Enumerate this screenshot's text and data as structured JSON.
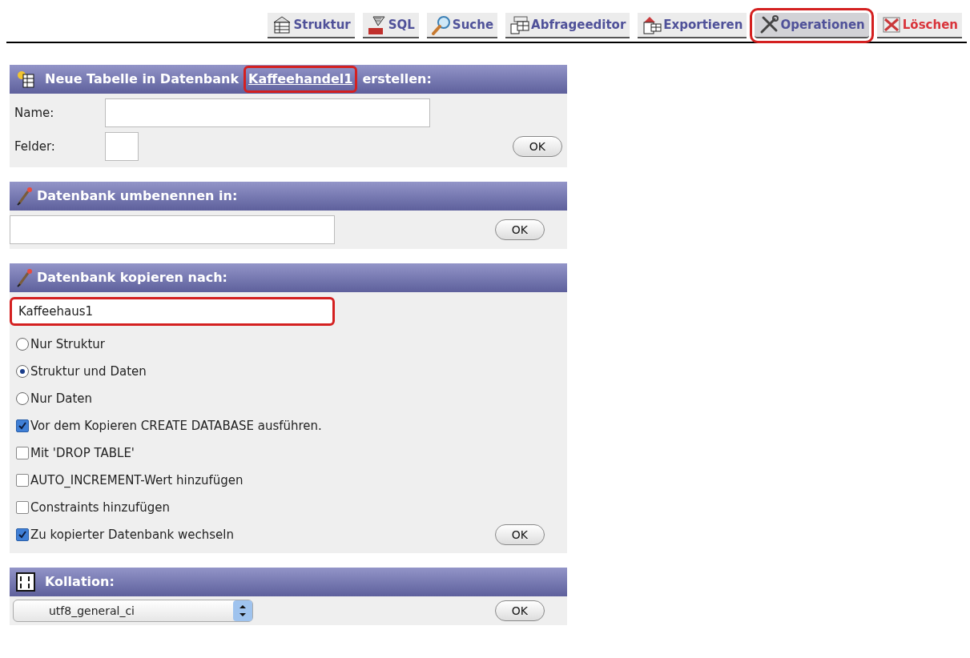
{
  "tabs": [
    {
      "label": "Struktur",
      "selected": false,
      "highlighted": false,
      "color": "#4f5199"
    },
    {
      "label": "SQL",
      "selected": false,
      "highlighted": false,
      "color": "#4f5199"
    },
    {
      "label": "Suche",
      "selected": false,
      "highlighted": false,
      "color": "#4f5199"
    },
    {
      "label": "Abfrageeditor",
      "selected": false,
      "highlighted": false,
      "color": "#4f5199"
    },
    {
      "label": "Exportieren",
      "selected": false,
      "highlighted": false,
      "color": "#4f5199"
    },
    {
      "label": "Operationen",
      "selected": true,
      "highlighted": true,
      "color": "#4f5199"
    },
    {
      "label": "Löschen",
      "selected": false,
      "highlighted": false,
      "color": "#d9343b"
    }
  ],
  "create_table": {
    "title_before": "Neue Tabelle in Datenbank",
    "database_link": "Kaffeehandel1",
    "link_highlighted": true,
    "title_after": "erstellen:",
    "fields": [
      {
        "label": "Name:",
        "kind": "wide"
      },
      {
        "label": "Felder:",
        "kind": "narrow"
      }
    ],
    "button": "OK"
  },
  "rename": {
    "title": "Datenbank umbenennen in:",
    "button": "OK"
  },
  "copy": {
    "title": "Datenbank kopieren nach:",
    "value": "Kaffeehaus1",
    "value_highlighted": true,
    "options": [
      {
        "kind": "radio",
        "label": "Nur Struktur",
        "selected": false
      },
      {
        "kind": "radio",
        "label": "Struktur und Daten",
        "selected": true
      },
      {
        "kind": "radio",
        "label": "Nur Daten",
        "selected": false
      },
      {
        "kind": "checkbox",
        "label": "Vor dem Kopieren CREATE DATABASE ausführen.",
        "checked": true
      },
      {
        "kind": "checkbox",
        "label": "Mit 'DROP TABLE'",
        "checked": false
      },
      {
        "kind": "checkbox",
        "label": "AUTO_INCREMENT-Wert hinzufügen",
        "checked": false
      },
      {
        "kind": "checkbox",
        "label": "Constraints hinzufügen",
        "checked": false
      },
      {
        "kind": "checkbox",
        "label": "Zu kopierter Datenbank wechseln",
        "checked": true
      }
    ],
    "button": "OK"
  },
  "collation": {
    "title": "Kollation:",
    "value": "utf8_general_ci",
    "button": "OK"
  }
}
